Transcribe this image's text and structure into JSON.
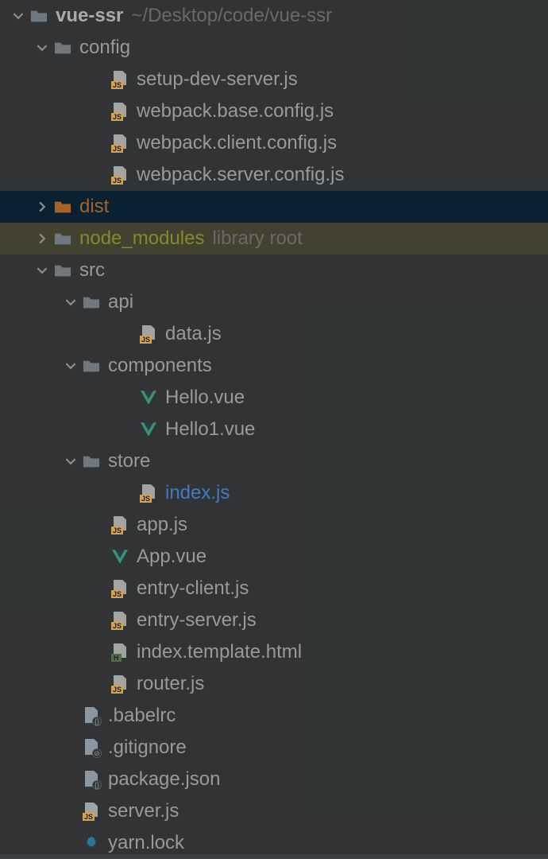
{
  "root": {
    "name": "vue-ssr",
    "path": "~/Desktop/code/vue-ssr"
  },
  "tree": {
    "config": {
      "label": "config",
      "files": [
        "setup-dev-server.js",
        "webpack.base.config.js",
        "webpack.client.config.js",
        "webpack.server.config.js"
      ]
    },
    "dist": {
      "label": "dist"
    },
    "node_modules": {
      "label": "node_modules",
      "suffix": "library root"
    },
    "src": {
      "label": "src",
      "api": {
        "label": "api",
        "files": [
          "data.js"
        ]
      },
      "components": {
        "label": "components",
        "files": [
          "Hello.vue",
          "Hello1.vue"
        ]
      },
      "store": {
        "label": "store",
        "files": [
          "index.js"
        ]
      },
      "files": [
        "app.js",
        "App.vue",
        "entry-client.js",
        "entry-server.js",
        "index.template.html",
        "router.js"
      ]
    },
    "rootFiles": [
      ".babelrc",
      ".gitignore",
      "package.json",
      "server.js",
      "yarn.lock"
    ]
  }
}
